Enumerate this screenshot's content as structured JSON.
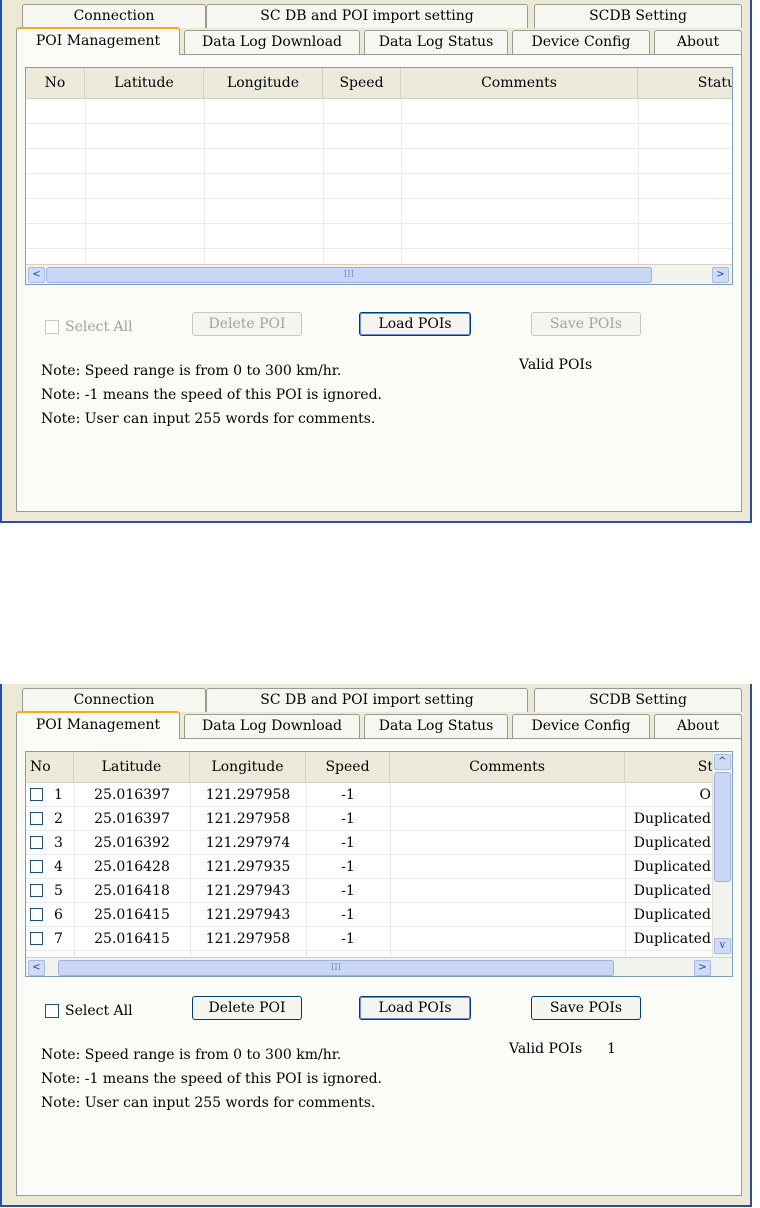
{
  "tabs": {
    "row1": [
      "Connection",
      "SC DB and POI import setting",
      "SCDB  Setting"
    ],
    "row2": [
      "POI Management",
      "Data Log Download",
      "Data Log Status",
      "Device Config",
      "About"
    ]
  },
  "columns": [
    "No",
    "Latitude",
    "Longitude",
    "Speed",
    "Comments",
    "Statu"
  ],
  "columns_b": [
    "No",
    "Latitude",
    "Longitude",
    "Speed",
    "Comments",
    "St"
  ],
  "rows": [
    {
      "no": "1",
      "lat": "25.016397",
      "lon": "121.297958",
      "speed": "-1",
      "comment": "",
      "status": "O"
    },
    {
      "no": "2",
      "lat": "25.016397",
      "lon": "121.297958",
      "speed": "-1",
      "comment": "",
      "status": "Duplicated"
    },
    {
      "no": "3",
      "lat": "25.016392",
      "lon": "121.297974",
      "speed": "-1",
      "comment": "",
      "status": "Duplicated"
    },
    {
      "no": "4",
      "lat": "25.016428",
      "lon": "121.297935",
      "speed": "-1",
      "comment": "",
      "status": "Duplicated"
    },
    {
      "no": "5",
      "lat": "25.016418",
      "lon": "121.297943",
      "speed": "-1",
      "comment": "",
      "status": "Duplicated"
    },
    {
      "no": "6",
      "lat": "25.016415",
      "lon": "121.297943",
      "speed": "-1",
      "comment": "",
      "status": "Duplicated"
    },
    {
      "no": "7",
      "lat": "25.016415",
      "lon": "121.297958",
      "speed": "-1",
      "comment": "",
      "status": "Duplicated"
    }
  ],
  "controls": {
    "select_all": "Select All",
    "delete": "Delete POI",
    "load": "Load POIs",
    "save": "Save POIs"
  },
  "notes": [
    "Note: Speed range is from 0 to 300 km/hr.",
    "Note: -1 means the speed of this POI is ignored.",
    "Note:  User can input 255 words for comments."
  ],
  "valid": {
    "label": "Valid POIs",
    "count_a": "",
    "count_b": "1"
  },
  "scroll": {
    "thumb_grip": "III",
    "left_arrow": "<",
    "right_arrow": ">",
    "up_arrow": "^",
    "down_arrow": "v"
  }
}
